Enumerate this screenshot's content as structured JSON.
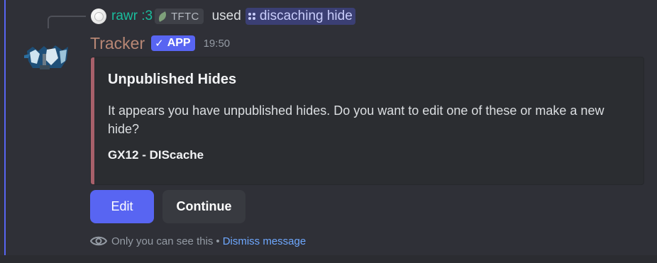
{
  "reply": {
    "author": "rawr :3",
    "tag": "TFTC",
    "used_text": "used",
    "command": "discaching hide"
  },
  "message": {
    "bot_name": "Tracker",
    "badge": "APP",
    "badge_check": "✓",
    "timestamp": "19:50"
  },
  "embed": {
    "title": "Unpublished Hides",
    "description": "It appears you have unpublished hides. Do you want to edit one of these or make a new hide?",
    "field": "GX12 - DIScache",
    "color": "#a8606a"
  },
  "buttons": {
    "edit_label": "Edit",
    "continue_label": "Continue"
  },
  "footer": {
    "visibility_text": "Only you can see this",
    "separator": "•",
    "dismiss_label": "Dismiss message"
  },
  "colors": {
    "accent": "#5865f2",
    "bot_name": "#b88775",
    "reply_name": "#1abc9c",
    "link": "#6ea8ff"
  }
}
